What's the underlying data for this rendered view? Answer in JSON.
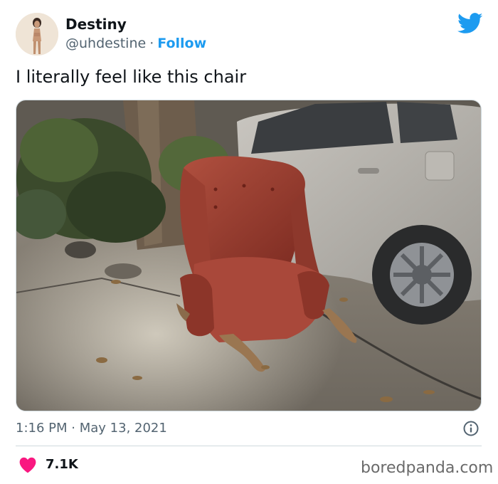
{
  "author": {
    "display_name": "Destiny",
    "handle": "@uhdestine",
    "separator": "·",
    "follow_label": "Follow"
  },
  "tweet": {
    "text": "I literally feel like this chair",
    "time": "1:16 PM",
    "separator": "·",
    "date": "May 13, 2021",
    "likes": "7.1K"
  },
  "icons": {
    "platform": "twitter-bird-icon",
    "info": "info-icon",
    "like": "heart-icon"
  },
  "watermark": "boredpanda.com",
  "colors": {
    "accent": "#1d9bf0",
    "like": "#f91880",
    "secondary_text": "#536471"
  }
}
